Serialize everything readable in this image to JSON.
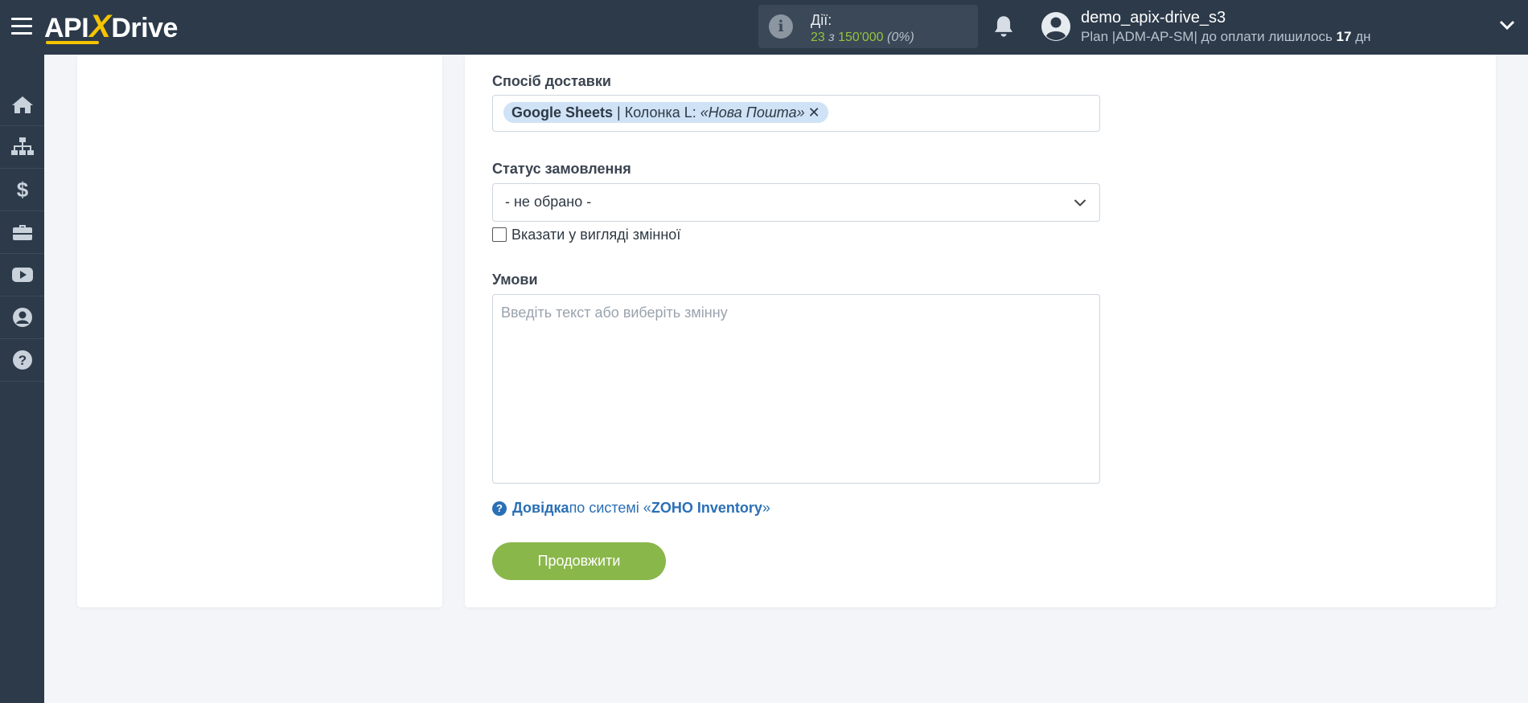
{
  "app": {
    "logo_api": "API",
    "logo_x": "X",
    "logo_drive": "Drive"
  },
  "header": {
    "actions_label": "Дії:",
    "actions_used": "23",
    "actions_sep": " з ",
    "actions_total": "150'000",
    "actions_percent": "(0%)",
    "user_name": "demo_apix-drive_s3",
    "plan_prefix": "Plan |ADM-AP-SM| до оплати лишилось ",
    "plan_days": "17",
    "plan_suffix": " дн"
  },
  "sidebar": {
    "items": [
      {
        "icon": "home-icon"
      },
      {
        "icon": "sitemap-icon"
      },
      {
        "icon": "dollar-icon"
      },
      {
        "icon": "briefcase-icon"
      },
      {
        "icon": "youtube-icon"
      },
      {
        "icon": "user-icon"
      },
      {
        "icon": "help-icon"
      }
    ]
  },
  "form": {
    "delivery": {
      "label": "Спосіб доставки",
      "tag_source": "Google Sheets",
      "tag_column": " | Колонка L: ",
      "tag_value": "«Нова Пошта»",
      "tag_remove": "✕"
    },
    "order_status": {
      "label": "Статус замовлення",
      "selected": "- не обрано -",
      "checkbox_label": "Вказати у вигляді змінної"
    },
    "conditions": {
      "label": "Умови",
      "placeholder": "Введіть текст або виберіть змінну"
    },
    "help": {
      "link_text": "Довідка",
      "middle": " по системі «",
      "system_name": "ZOHO Inventory",
      "end": "»"
    },
    "continue_label": "Продовжити"
  },
  "colors": {
    "topbar": "#2c3a4a",
    "accent_yellow": "#f5c400",
    "actions_green": "#97c33f",
    "button_green": "#8ab74a",
    "link_blue": "#2a6fb5",
    "tag_blue": "#cfe2f6"
  }
}
